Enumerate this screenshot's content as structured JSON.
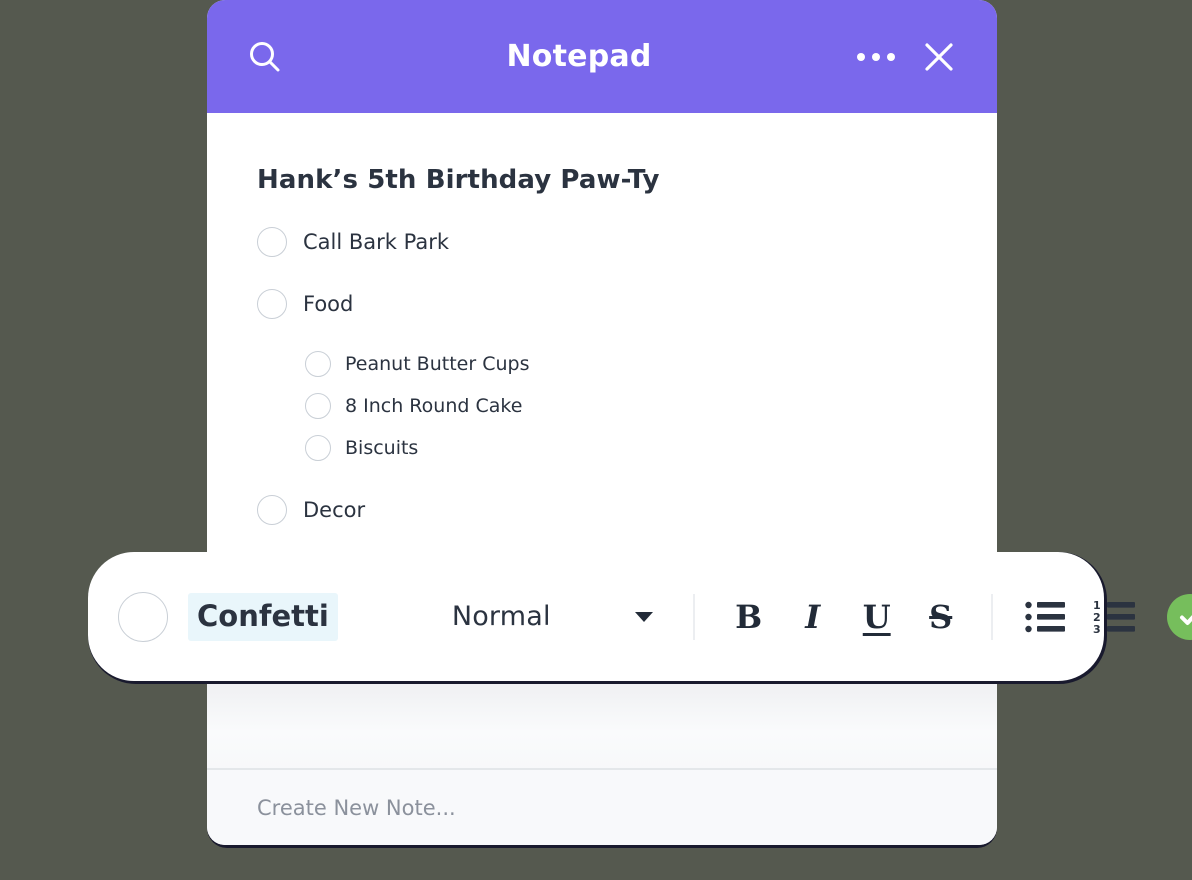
{
  "colors": {
    "header_purple": "#7a68ec",
    "accent_green": "#76be5c",
    "highlight_cyan": "#e9f6fb",
    "text_dark": "#2b3340",
    "placeholder_gray": "#8b919c",
    "checkbox_border": "#c9cfd6",
    "shadow_navy": "#191a2e",
    "page_background": "#55594f"
  },
  "header": {
    "title": "Notepad",
    "search_icon": "search-icon",
    "more_icon": "more-options-icon",
    "close_icon": "close-icon"
  },
  "note": {
    "title": "Hank’s 5th Birthday Paw-Ty",
    "items": [
      {
        "label": "Call Bark Park",
        "level": 0,
        "checked": false
      },
      {
        "label": "Food",
        "level": 0,
        "checked": false
      },
      {
        "label": "Peanut Butter Cups",
        "level": 1,
        "checked": false
      },
      {
        "label": "8 Inch Round Cake",
        "level": 1,
        "checked": false
      },
      {
        "label": "Biscuits",
        "level": 1,
        "checked": false
      },
      {
        "label": "Decor",
        "level": 0,
        "checked": false
      }
    ]
  },
  "toolbar": {
    "editing_text": "Confetti",
    "style_label": "Normal",
    "caret_icon": "chevron-down-icon",
    "bold_label": "B",
    "italic_label": "I",
    "underline_label": "U",
    "strikethrough_label": "S",
    "bullet_list_icon": "bulleted-list-icon",
    "numbered_list_icon": "numbered-list-icon",
    "numbered_list_digits": [
      "1",
      "2",
      "3"
    ],
    "confirm_icon": "check-circle-icon"
  },
  "footer": {
    "new_note_placeholder": "Create New Note..."
  }
}
